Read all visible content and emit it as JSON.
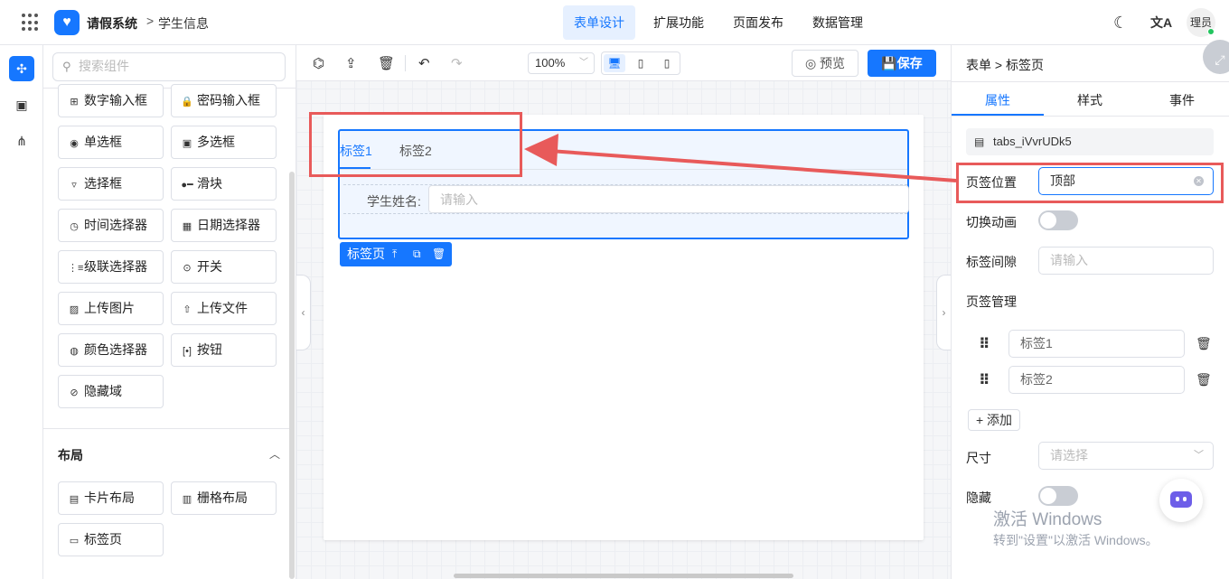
{
  "header": {
    "app_title": "请假系统",
    "breadcrumb_arrow": ">",
    "breadcrumb": "学生信息",
    "logo_glyph": "♥",
    "tabs": [
      {
        "label": "表单设计",
        "active": true
      },
      {
        "label": "扩展功能",
        "active": false
      },
      {
        "label": "页面发布",
        "active": false
      },
      {
        "label": "数据管理",
        "active": false
      }
    ],
    "theme_icon": "moon-icon",
    "translate_icon": "translate-icon",
    "translate_glyph": "文A",
    "avatar_text": "理员",
    "accent_color": "#1677ff"
  },
  "rail": {
    "items": [
      "puzzle-icon",
      "code-block-icon",
      "tree-icon"
    ]
  },
  "components": {
    "search_placeholder": "搜索组件",
    "items": [
      {
        "label": "数字输入框",
        "icon": "number-icon",
        "glyph": "⊞"
      },
      {
        "label": "密码输入框",
        "icon": "lock-icon",
        "glyph": "🔒"
      },
      {
        "label": "单选框",
        "icon": "radio-icon",
        "glyph": "◉"
      },
      {
        "label": "多选框",
        "icon": "checkbox-icon",
        "glyph": "▣"
      },
      {
        "label": "选择框",
        "icon": "select-icon",
        "glyph": "▿"
      },
      {
        "label": "滑块",
        "icon": "slider-icon",
        "glyph": "●━"
      },
      {
        "label": "时间选择器",
        "icon": "clock-icon",
        "glyph": "◷"
      },
      {
        "label": "日期选择器",
        "icon": "calendar-icon",
        "glyph": "▦"
      },
      {
        "label": "级联选择器",
        "icon": "cascade-icon",
        "glyph": "⋮≡"
      },
      {
        "label": "开关",
        "icon": "switch-icon",
        "glyph": "⊙"
      },
      {
        "label": "上传图片",
        "icon": "image-icon",
        "glyph": "▨"
      },
      {
        "label": "上传文件",
        "icon": "upload-icon",
        "glyph": "⇧"
      },
      {
        "label": "颜色选择器",
        "icon": "palette-icon",
        "glyph": "◍"
      },
      {
        "label": "按钮",
        "icon": "button-icon",
        "glyph": "[•]"
      },
      {
        "label": "隐藏域",
        "icon": "eye-off-icon",
        "glyph": "⊘"
      }
    ],
    "layout_title": "布局",
    "layout_items": [
      {
        "label": "卡片布局",
        "icon": "card-icon",
        "glyph": "▤"
      },
      {
        "label": "栅格布局",
        "icon": "columns-icon",
        "glyph": "▥"
      },
      {
        "label": "标签页",
        "icon": "tabs-icon",
        "glyph": "▭"
      }
    ]
  },
  "toolbar": {
    "zoom": "100%",
    "preview_label": "预览",
    "save_label": "保存"
  },
  "canvas": {
    "tabs": [
      {
        "label": "标签1",
        "active": true
      },
      {
        "label": "标签2",
        "active": false
      }
    ],
    "field_label": "学生姓名:",
    "field_placeholder": "请输入",
    "selected_tag": "标签页"
  },
  "props": {
    "breadcrumb": "表单 > 标签页",
    "tabs": [
      {
        "label": "属性",
        "active": true
      },
      {
        "label": "样式",
        "active": false
      },
      {
        "label": "事件",
        "active": false
      }
    ],
    "component_id": "tabs_iVvrUDk5",
    "position_label": "页签位置",
    "position_value": "顶部",
    "animation_label": "切换动画",
    "animation_on": false,
    "gap_label": "标签间隙",
    "gap_placeholder": "请输入",
    "manage_label": "页签管理",
    "tab_items": [
      "标签1",
      "标签2"
    ],
    "add_label": "+ 添加",
    "size_label": "尺寸",
    "size_placeholder": "请选择",
    "hidden_label": "隐藏",
    "hidden_on": false
  },
  "watermark": {
    "line1": "激活 Windows",
    "line2": "转到\"设置\"以激活 Windows。"
  },
  "annotation_color": "#e85a5a"
}
